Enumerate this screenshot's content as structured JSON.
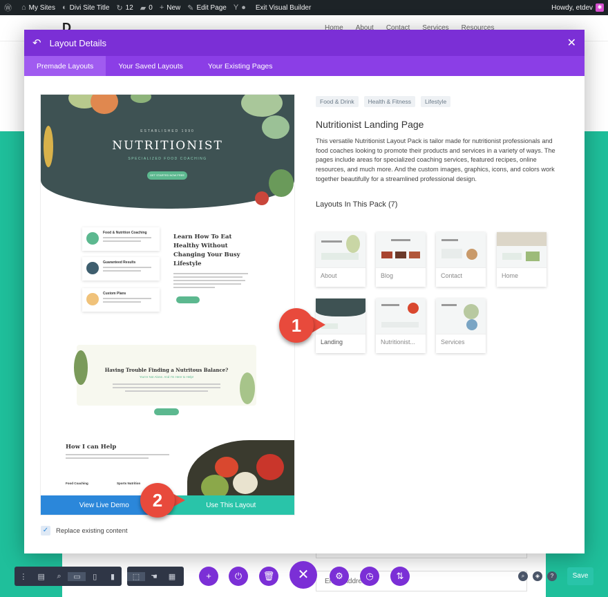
{
  "admin_bar": {
    "wp_icon": "wordpress-icon",
    "my_sites": "My Sites",
    "site_title": "Divi Site Title",
    "updates_count": "12",
    "comments_count": "0",
    "new_label": "New",
    "edit_page": "Edit Page",
    "exit_builder": "Exit Visual Builder",
    "greeting": "Howdy, etdev"
  },
  "site_nav": {
    "logo": "D",
    "items": [
      "Home",
      "About",
      "Contact",
      "Services",
      "Resources"
    ]
  },
  "modal": {
    "title": "Layout Details",
    "tabs": [
      "Premade Layouts",
      "Your Saved Layouts",
      "Your Existing Pages"
    ],
    "active_tab": "Premade Layouts",
    "preview": {
      "hero_small": "ESTABLISHED 1990",
      "hero_title": "NUTRITIONIST",
      "hero_sub": "SPECIALIZED FOOD COACHING",
      "hero_button": "GET STARTED NOW FREE",
      "services": [
        "Food & Nutrition Coaching",
        "Guaranteed Results",
        "Custom Plans"
      ],
      "learn_heading": "Learn How To Eat Healthy Without Changing Your Busy Lifestyle",
      "contact_button": "CONTACT ME",
      "trouble_heading": "Having Trouble Finding a Nutritous Balance?",
      "trouble_sub": "You're Not Alone. And I'm Here to Help!",
      "trouble_button": "CONTACT ME",
      "help_heading": "How I can Help",
      "help_items": [
        "Food Coaching",
        "Sports Nutrition"
      ],
      "view_demo": "View Live Demo",
      "use_layout": "Use This Layout"
    },
    "replace_label": "Replace existing content",
    "replace_checked": true,
    "details": {
      "tags": [
        "Food & Drink",
        "Health & Fitness",
        "Lifestyle"
      ],
      "title": "Nutritionist Landing Page",
      "description": "This versatile Nutritionist Layout Pack is tailor made for nutritionist professionals and food coaches looking to promote their products and services in a variety of ways. The pages include areas for specialized coaching services, featured recipes, online resources, and much more. And the custom images, graphics, icons, and colors work together beautifully for a streamlined professional design.",
      "pack_heading": "Layouts In This Pack (7)",
      "layouts": [
        "About",
        "Blog",
        "Contact",
        "Home",
        "Landing",
        "Nutritionist...",
        "Services"
      ]
    }
  },
  "annotations": [
    "1",
    "2"
  ],
  "bottom_bar": {
    "save": "Save",
    "email_placeholder": "Email Address"
  },
  "colors": {
    "purple": "#7b2fd6",
    "teal": "#29c4a9",
    "blue": "#2b87da",
    "badge_red": "#e84a3c"
  }
}
